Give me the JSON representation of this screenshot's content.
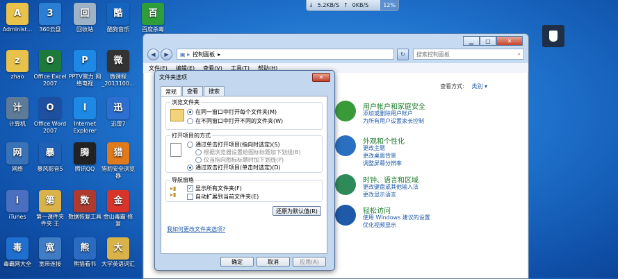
{
  "desktop": {
    "icons": [
      {
        "label": "Administ...",
        "color": "#e8c24a"
      },
      {
        "label": "360云盘",
        "color": "#2a7fd4"
      },
      {
        "label": "回收站",
        "color": "#9fb2c6"
      },
      {
        "label": "酷狗音乐",
        "color": "#1565c0"
      },
      {
        "label": "百度杀毒",
        "color": "#2e9e3a"
      },
      {
        "label": "zhao",
        "color": "#e8c24a"
      },
      {
        "label": "Office Excel 2007",
        "color": "#1d7a3a"
      },
      {
        "label": "PPTV聚力 网络电视",
        "color": "#1e88e5"
      },
      {
        "label": "微课程 _2013100...",
        "color": "#333333"
      },
      {
        "label": "计算机",
        "color": "#5d7b99"
      },
      {
        "label": "Office Word 2007",
        "color": "#1f4fa0"
      },
      {
        "label": "Internet Explorer",
        "color": "#1e88e5"
      },
      {
        "label": "迅雷7",
        "color": "#2d6fd0"
      },
      {
        "label": "网络",
        "color": "#3a72b8"
      },
      {
        "label": "暴风影音5",
        "color": "#1f5fb5"
      },
      {
        "label": "腾讯QQ",
        "color": "#222222"
      },
      {
        "label": "猎豹安全浏览器",
        "color": "#e07a1a"
      },
      {
        "label": "iTunes",
        "color": "#4a6fc0"
      },
      {
        "label": "第一课件夹 件夹 王",
        "color": "#d9b24a"
      },
      {
        "label": "数据恢复工具",
        "color": "#b03a2e"
      },
      {
        "label": "金山毒霸 修复",
        "color": "#d9342a"
      },
      {
        "label": "毒霸网大全",
        "color": "#1f6fd0"
      },
      {
        "label": "宽带连接",
        "color": "#3f7cc4"
      },
      {
        "label": "熊猫看书",
        "color": "#2b6cc2"
      },
      {
        "label": "大学英语词汇",
        "color": "#d9b24a"
      }
    ]
  },
  "netmeter": {
    "down": "5.2KB/S",
    "up": "0KB/S",
    "cpu": "12%"
  },
  "controlpanel": {
    "address": "控制面板",
    "search_placeholder": "搜索控制面板",
    "menu": [
      "文件(F)",
      "编辑(E)",
      "查看(V)",
      "工具(T)",
      "帮助(H)"
    ],
    "viewby_label": "查看方式:",
    "viewby_value": "类别",
    "categories": [
      {
        "title": "用户帐户和家庭安全",
        "links": [
          "添加或删除用户帐户",
          "为所有用户设置家长控制"
        ]
      },
      {
        "title": "外观和个性化",
        "links": [
          "更改主题",
          "更改桌面背景",
          "调整屏幕分辨率"
        ]
      },
      {
        "title": "时钟、语言和区域",
        "links": [
          "更改键盘或其他输入法",
          "更改显示语言"
        ]
      },
      {
        "title": "轻松访问",
        "links": [
          "使用 Windows 建议的设置",
          "优化视频显示"
        ]
      }
    ]
  },
  "folder_options": {
    "title": "文件夹选项",
    "close": "✕",
    "tabs": [
      "常规",
      "查看",
      "搜索"
    ],
    "browse_group": "浏览文件夹",
    "browse_opt1": "在同一窗口中打开每个文件夹(M)",
    "browse_opt2": "在不同窗口中打开不同的文件夹(W)",
    "click_group": "打开项目的方式",
    "click_opt1": "通过单击打开项目(指向时选定)(S)",
    "click_sub1": "根据浏览器设置给图标标题加下划线(B)",
    "click_sub2": "仅当指向图标标题时加下划线(P)",
    "click_opt2": "通过双击打开项目(单击时选定)(D)",
    "nav_group": "导航窗格",
    "nav_opt1": "显示所有文件夹(F)",
    "nav_opt2": "自动扩展到当前文件夹(E)",
    "restore_button": "还原为默认值(R)",
    "help_link": "我如何更改文件夹选项?",
    "ok": "确定",
    "cancel": "取消",
    "apply": "应用(A)"
  }
}
